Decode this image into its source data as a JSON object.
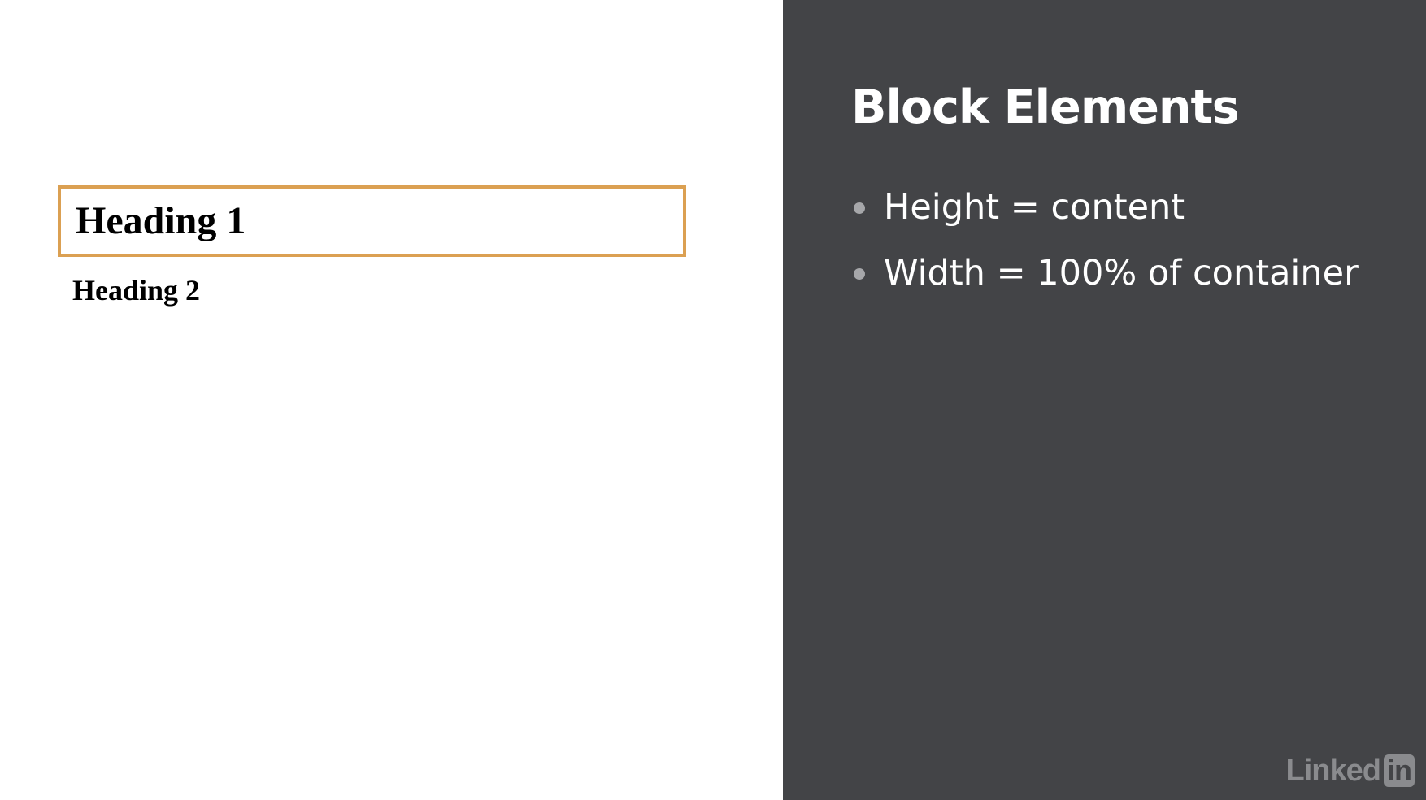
{
  "left_demo": {
    "heading1": "Heading 1",
    "heading2": "Heading 2",
    "highlight_color": "#dba052"
  },
  "slide": {
    "title": "Block Elements",
    "bullets": [
      "Height = content",
      "Width = 100% of container"
    ],
    "background_color": "#434447"
  },
  "branding": {
    "logo_word": "Linked",
    "logo_box": "in"
  }
}
